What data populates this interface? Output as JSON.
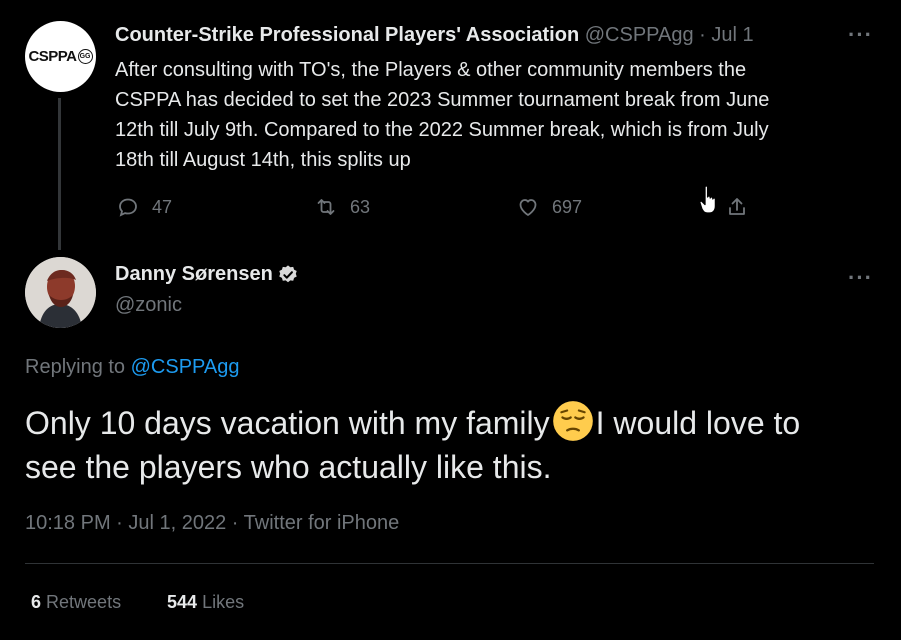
{
  "quoted": {
    "avatar_text": "CSPPA",
    "avatar_badge": "GG",
    "display_name": "Counter-Strike Professional Players' Association",
    "handle": "@CSPPAgg",
    "separator": "·",
    "date": "Jul 1",
    "more": "···",
    "text_lines": [
      "After consulting with TO's, the Players & other community members the",
      "CSPPA has decided to set the 2023 Summer tournament break from June",
      "12th till July 9th. Compared to the 2022 Summer break, which is from July",
      "18th till August 14th, this splits up"
    ],
    "replies": "47",
    "retweets": "63",
    "likes": "697"
  },
  "main": {
    "display_name": "Danny Sørensen",
    "handle": "@zonic",
    "more": "···",
    "replying_prefix": "Replying to",
    "replying_handle": "@CSPPAgg",
    "text_before_emoji": "Only 10 days vacation with my family",
    "emoji_name": "pensive-face",
    "text_after_emoji": "I would love to",
    "text_line2": "see the players who actually like this.",
    "meta": "10:18 PM · Jul 1, 2022 · Twitter for iPhone",
    "retweets_count": "6",
    "retweets_label": "Retweets",
    "likes_count": "544",
    "likes_label": "Likes"
  },
  "colors": {
    "background": "#000000",
    "text": "#e7e9ea",
    "muted": "#71767b",
    "link": "#1d9bf0",
    "divider": "#2f3336"
  }
}
